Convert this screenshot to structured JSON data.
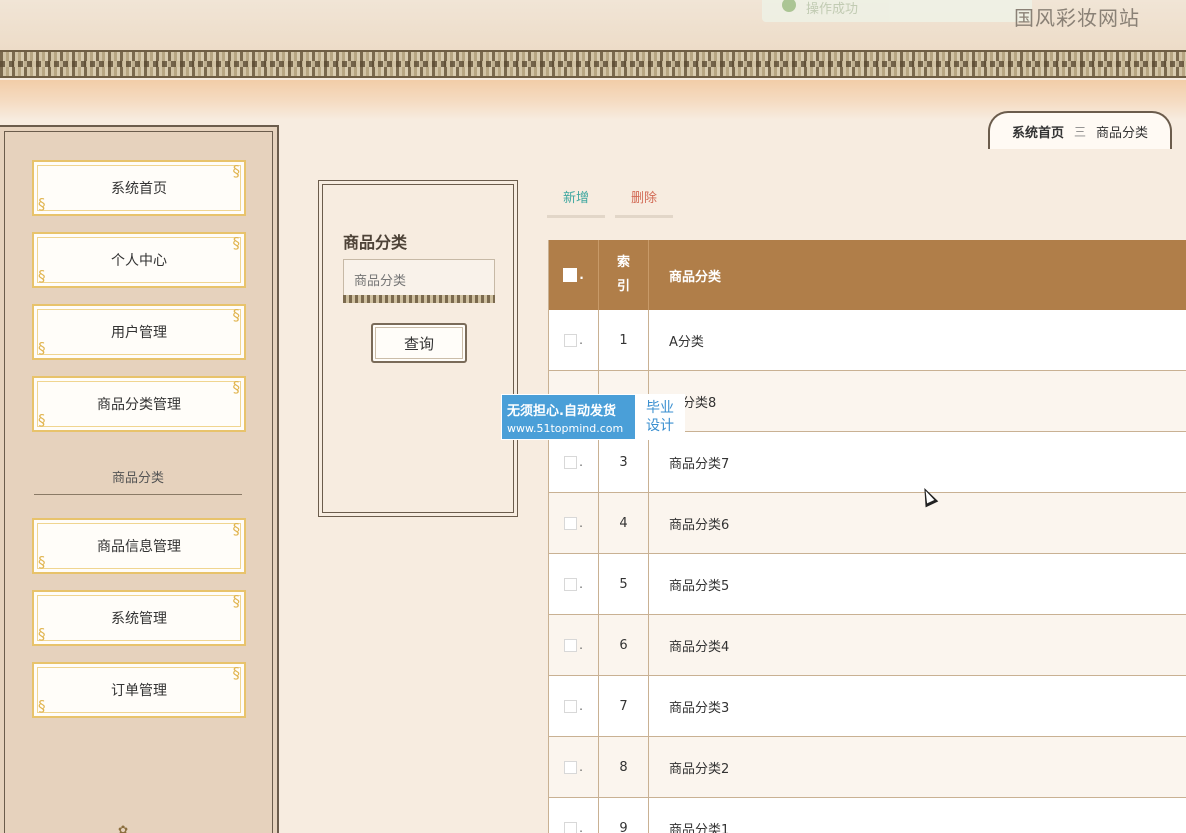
{
  "header": {
    "toast_text": "操作成功",
    "site_title": "国风彩妆网站"
  },
  "breadcrumb": {
    "home": "系统首页",
    "separator": "三",
    "current": "商品分类"
  },
  "sidebar": {
    "items": [
      {
        "label": "系统首页"
      },
      {
        "label": "个人中心"
      },
      {
        "label": "用户管理"
      },
      {
        "label": "商品分类管理"
      },
      {
        "label": "商品信息管理"
      },
      {
        "label": "系统管理"
      },
      {
        "label": "订单管理"
      }
    ],
    "submenu_label": "商品分类"
  },
  "search": {
    "label": "商品分类",
    "placeholder": "商品分类",
    "button_label": "查询"
  },
  "toolbar": {
    "add_label": "新增",
    "delete_label": "删除"
  },
  "table": {
    "headers": {
      "index_line1": "索",
      "index_line2": "引",
      "name": "商品分类"
    },
    "rows": [
      {
        "index": "1",
        "name": "A分类"
      },
      {
        "index": "",
        "name": "品分类8"
      },
      {
        "index": "3",
        "name": "商品分类7"
      },
      {
        "index": "4",
        "name": "商品分类6"
      },
      {
        "index": "5",
        "name": "商品分类5"
      },
      {
        "index": "6",
        "name": "商品分类4"
      },
      {
        "index": "7",
        "name": "商品分类3"
      },
      {
        "index": "8",
        "name": "商品分类2"
      },
      {
        "index": "9",
        "name": "商品分类1"
      }
    ]
  },
  "watermark": {
    "line1": "无须担心.自动发货",
    "line2": "www.51topmind.com",
    "right_line1": "毕业",
    "right_line2": "设计"
  },
  "colors": {
    "table_header": "#b07e49",
    "add_button": "#3fa7a0",
    "delete_button": "#d26a55",
    "sidebar_bg": "#e6d2bd",
    "menu_border": "#e8c36b"
  }
}
